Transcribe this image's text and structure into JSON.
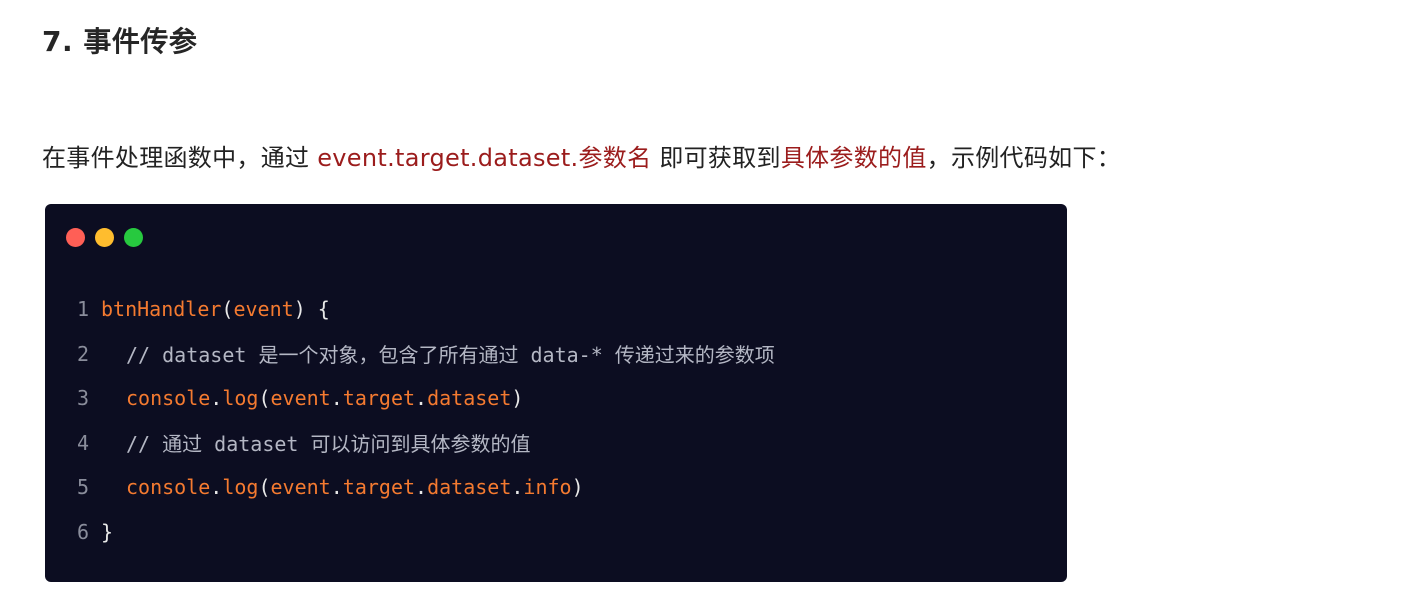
{
  "heading": "7. 事件传参",
  "paragraph": {
    "prefix": "在事件处理函数中，通过 ",
    "code_ref": "event.target.dataset.参数名",
    "middle": " 即可获取到",
    "emphasis": "具体参数的值",
    "suffix": "，示例代码如下："
  },
  "window_dots": [
    "close",
    "minimize",
    "maximize"
  ],
  "colors": {
    "accent_red": "#9b1c1c",
    "code_bg": "#0c0d21",
    "token_orange": "#f47a30",
    "dot_red": "#ff5f56",
    "dot_yellow": "#ffbd2e",
    "dot_green": "#27c93f"
  },
  "code": {
    "line_numbers": [
      "1",
      "2",
      "3",
      "4",
      "5",
      "6"
    ],
    "line1": {
      "fn": "btnHandler",
      "open": "(",
      "param": "event",
      "close": ") {"
    },
    "line2": {
      "comment": "// dataset 是一个对象，包含了所有通过 data-* 传递过来的参数项"
    },
    "line3": {
      "obj": "console",
      "dot1": ".",
      "method": "log",
      "open": "(",
      "a": "event",
      "d1": ".",
      "b": "target",
      "d2": ".",
      "c": "dataset",
      "close": ")"
    },
    "line4": {
      "comment": "// 通过 dataset 可以访问到具体参数的值"
    },
    "line5": {
      "obj": "console",
      "dot1": ".",
      "method": "log",
      "open": "(",
      "a": "event",
      "d1": ".",
      "b": "target",
      "d2": ".",
      "c": "dataset",
      "d3": ".",
      "d": "info",
      "close": ")"
    },
    "line6": {
      "text": "}"
    }
  }
}
